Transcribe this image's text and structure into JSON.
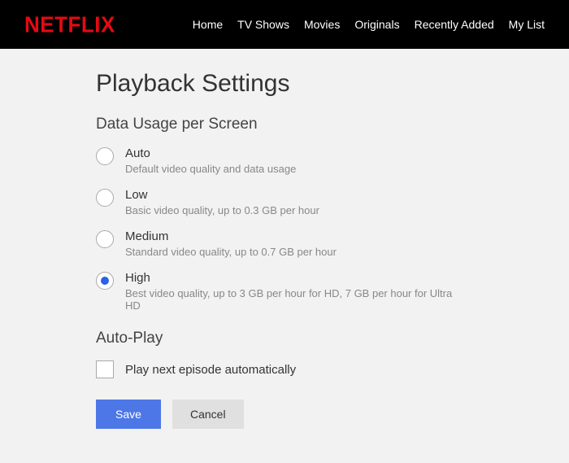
{
  "header": {
    "logo": "NETFLIX",
    "nav": {
      "home": "Home",
      "tvshows": "TV Shows",
      "movies": "Movies",
      "originals": "Originals",
      "recent": "Recently Added",
      "mylist": "My List"
    }
  },
  "page": {
    "title": "Playback Settings",
    "section_data_usage": "Data Usage per Screen",
    "options": {
      "auto": {
        "label": "Auto",
        "desc": "Default video quality and data usage",
        "selected": false
      },
      "low": {
        "label": "Low",
        "desc": "Basic video quality, up to 0.3 GB per hour",
        "selected": false
      },
      "medium": {
        "label": "Medium",
        "desc": "Standard video quality, up to 0.7 GB per hour",
        "selected": false
      },
      "high": {
        "label": "High",
        "desc": "Best video quality, up to 3 GB per hour for HD, 7 GB per hour for Ultra HD",
        "selected": true
      }
    },
    "section_autoplay": "Auto-Play",
    "autoplay_label": "Play next episode automatically",
    "autoplay_checked": false,
    "buttons": {
      "save": "Save",
      "cancel": "Cancel"
    }
  }
}
